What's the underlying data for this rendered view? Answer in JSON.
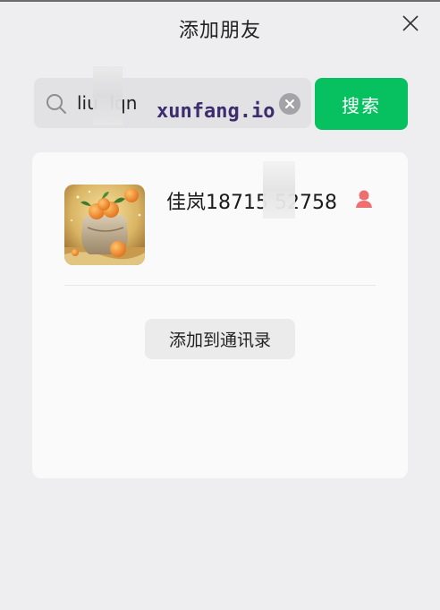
{
  "window": {
    "title": "添加朋友",
    "close_icon": "close-icon"
  },
  "search": {
    "value": "liu  lqn",
    "icon": "search-icon",
    "clear_icon": "clear-circle-icon",
    "button_label": "搜索",
    "button_color": "#07c160"
  },
  "watermark": {
    "text": "xunfang.io"
  },
  "result": {
    "avatar_icon": "avatar-image",
    "name": "佳岚18715 52758",
    "gender_icon": "female-user-icon",
    "gender_color": "#ee6f6f",
    "add_button_label": "添加到通讯录"
  }
}
